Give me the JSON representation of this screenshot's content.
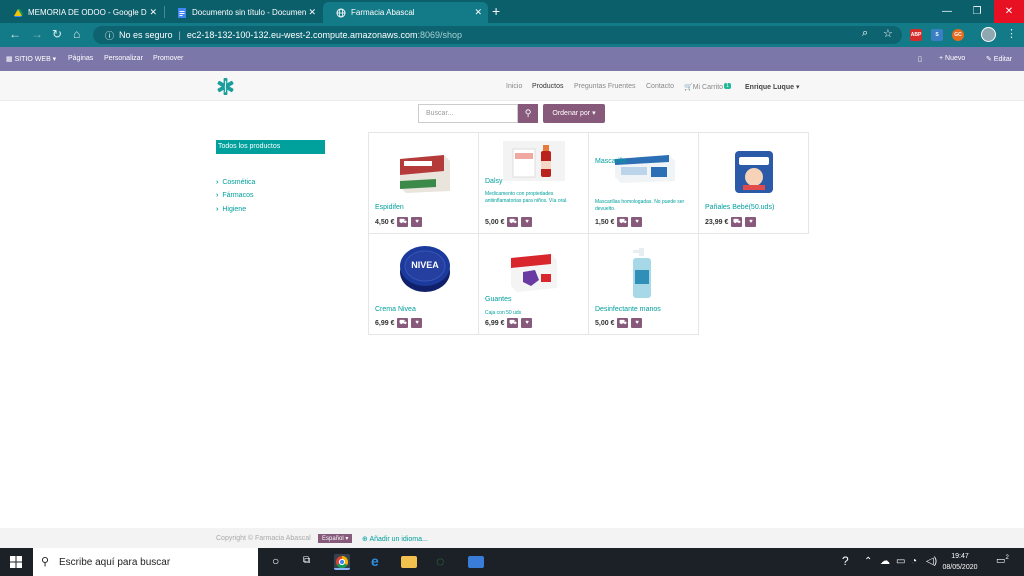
{
  "browser": {
    "tabs": [
      {
        "title": "MEMORIA DE ODOO - Google D",
        "close": "✕"
      },
      {
        "title": "Documento sin título - Documen",
        "close": "✕"
      },
      {
        "title": "Farmacia Abascal",
        "close": "✕"
      }
    ],
    "new_tab": "+",
    "window_controls": [
      "—",
      "❐",
      "✕"
    ],
    "nav": {
      "back": "←",
      "forward": "→",
      "reload": "↻",
      "home": "⌂"
    },
    "address": {
      "security": "No es seguro",
      "host": "ec2-18-132-100-132.eu-west-2.compute.amazonaws.com",
      "path": ":8069/shop"
    },
    "extensions": {
      "abp": "ABP",
      "s": "S",
      "gc": "GC"
    }
  },
  "odoo_bar": {
    "site": "SITIO WEB",
    "menu": [
      "Páginas",
      "Personalizar",
      "Promover"
    ],
    "new": "+ Nuevo",
    "edit": "✎ Editar"
  },
  "site_nav": {
    "items": [
      "Inicio",
      "Productos",
      "Preguntas Fruentes",
      "Contacto"
    ],
    "cart": "Mi Carrito",
    "cart_count": "1",
    "user": "Enrique Luque"
  },
  "shop": {
    "search_placeholder": "Buscar...",
    "sort": "Ordenar por",
    "all_products": "Todos los productos",
    "categories": [
      "Cosmética",
      "Fármacos",
      "Higiene"
    ],
    "products": [
      {
        "name": "Espidifen",
        "desc": "",
        "price": "4,50 €"
      },
      {
        "name": "Dalsy",
        "desc": "Medicamento con propiedades antiinflamatorias para niños. Vía oral.",
        "price": "5,00 €"
      },
      {
        "name": "Mascarilla",
        "desc": "Mascarillas homologadas. No puede ser devuelto.",
        "price": "1,50 €"
      },
      {
        "name": "Pañales Bebé(50.uds)",
        "desc": "",
        "price": "23,99 €"
      },
      {
        "name": "Crema Nivea",
        "desc": "",
        "price": "6,99 €"
      },
      {
        "name": "Guantes",
        "desc": "Caja con 50 uds",
        "price": "6,99 €"
      },
      {
        "name": "Desinfectante manos",
        "desc": "",
        "price": "5,00 €"
      }
    ]
  },
  "footer": {
    "copyright": "Copyright © Farmacia Abascal",
    "language": "Español",
    "add_language": "Añadir un idioma..."
  },
  "taskbar": {
    "search": "Escribe aquí para buscar",
    "time": "19:47",
    "date": "08/05/2020",
    "notifications": "2"
  },
  "colors": {
    "teal": "#00a09d",
    "odoo_purple": "#875a7b",
    "bar": "#7c77a9",
    "chrome": "#137a87"
  }
}
